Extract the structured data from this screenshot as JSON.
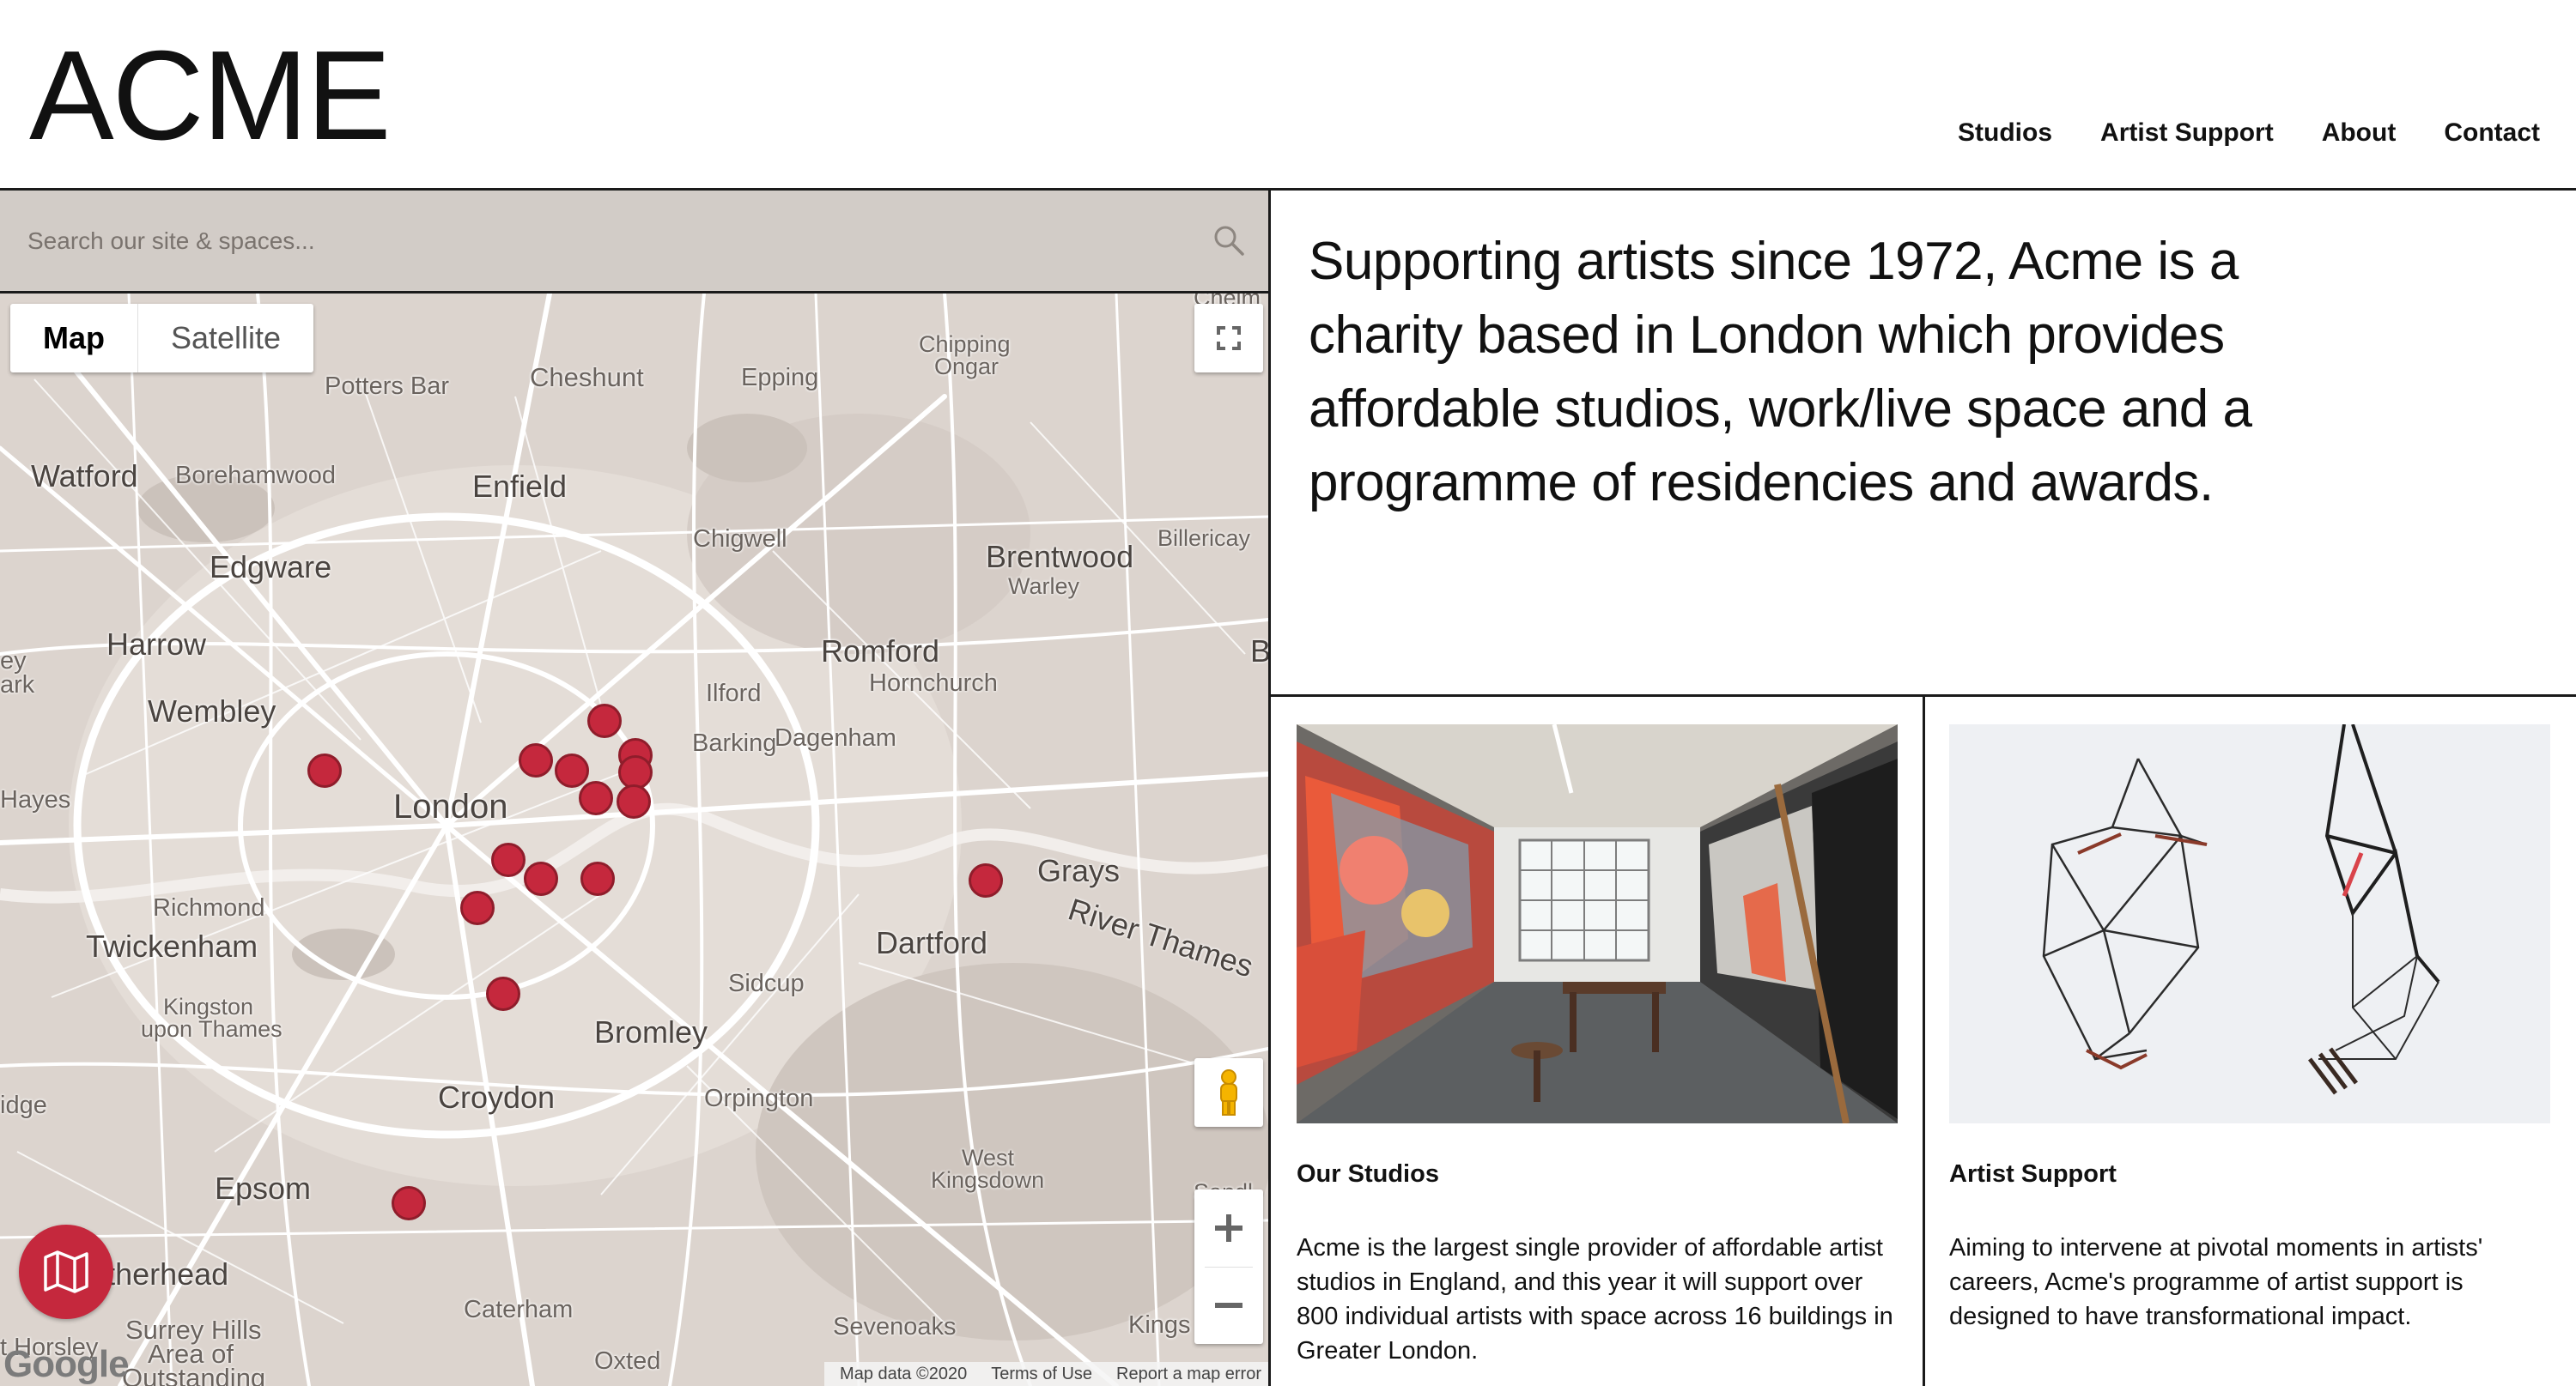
{
  "header": {
    "logo": "ACME",
    "nav": [
      "Studios",
      "Artist Support",
      "About",
      "Contact"
    ]
  },
  "search": {
    "placeholder": "Search our site & spaces...",
    "icon": "search-icon"
  },
  "map": {
    "map_type_buttons": [
      "Map",
      "Satellite"
    ],
    "active_map_type": "Map",
    "places": [
      "Potters Bar",
      "Cheshunt",
      "Epping",
      "Chipping",
      "Ongar",
      "Watford",
      "Borehamwood",
      "Enfield",
      "Chigwell",
      "Brentwood",
      "Billericay",
      "Warley",
      "Edgware",
      "Harrow",
      "Romford",
      "Hornchurch",
      "Wembley",
      "Ilford",
      "Barking",
      "Dagenham",
      "London",
      "Grays",
      "Richmond",
      "Twickenham",
      "Dartford",
      "River Thames",
      "Kingston",
      "upon Thames",
      "Sidcup",
      "Bromley",
      "Croydon",
      "Orpington",
      "West",
      "Kingsdown",
      "Epsom",
      "Leatherhead",
      "Caterham",
      "Surrey Hills",
      "Area of",
      "Outstanding",
      "Sevenoaks",
      "Oxted",
      "Kings",
      "Hayes",
      "ark",
      "ey",
      "idge",
      "t Horsley",
      "Chelm",
      "Sandl",
      "Ba"
    ],
    "logo": "Google",
    "attribution": [
      "Map data ©2020",
      "Terms of Use",
      "Report a map error"
    ],
    "colors": {
      "marker": "#c5283d",
      "land": "#dcd4ce",
      "roads": "#ffffff",
      "search_bar": "#d2ccc7"
    }
  },
  "intro": {
    "text": "Supporting artists since 1972, Acme is a charity based in London which provides affordable studios, work/live space and a programme of residencies and awards."
  },
  "cards": [
    {
      "title": "Our Studios",
      "text": "Acme is the largest single provider of affordable artist studios in England, and this year it will support over 800 individual artists with space across 16 buildings in Greater London."
    },
    {
      "title": "Artist Support",
      "text": "Aiming to intervene at pivotal moments in artists' careers, Acme's programme of artist support is designed to have transformational impact."
    }
  ]
}
